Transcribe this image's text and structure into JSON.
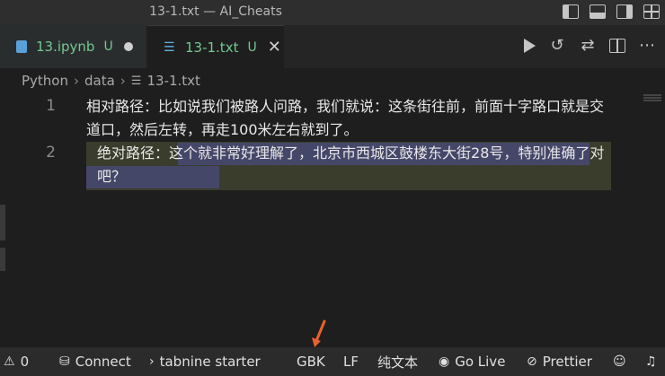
{
  "window": {
    "title": "13-1.txt — AI_Cheats"
  },
  "tabs": [
    {
      "label": "13.ipynb",
      "status": "U",
      "icon": "notebook-icon",
      "dirty": true
    },
    {
      "label": "13-1.txt",
      "status": "U",
      "icon": "text-file-icon",
      "active": true
    }
  ],
  "breadcrumb": {
    "items": [
      "Python",
      "data",
      "13-1.txt"
    ]
  },
  "editor": {
    "lines": [
      {
        "number": "1",
        "text": "相对路径：比如说我们被路人问路，我们就说：这条街往前，前面十字路口就是交道口，然后左转，再走100米左右就到了。"
      },
      {
        "number": "2",
        "prefix": "绝对路径：",
        "selected": "这个就非常好理解了，北京市西城区鼓楼东大街28号，特别准确了对吧？"
      }
    ]
  },
  "statusbar": {
    "errors": "0",
    "warnings": "0",
    "connect": "Connect",
    "tabnine": "tabnine starter",
    "encoding": "GBK",
    "eol": "LF",
    "language": "纯文本",
    "golive": "Go Live",
    "prettier": "Prettier"
  },
  "colors": {
    "modified": "#73c991",
    "selection": "#454769",
    "annotation_arrow": "#e8622c"
  }
}
